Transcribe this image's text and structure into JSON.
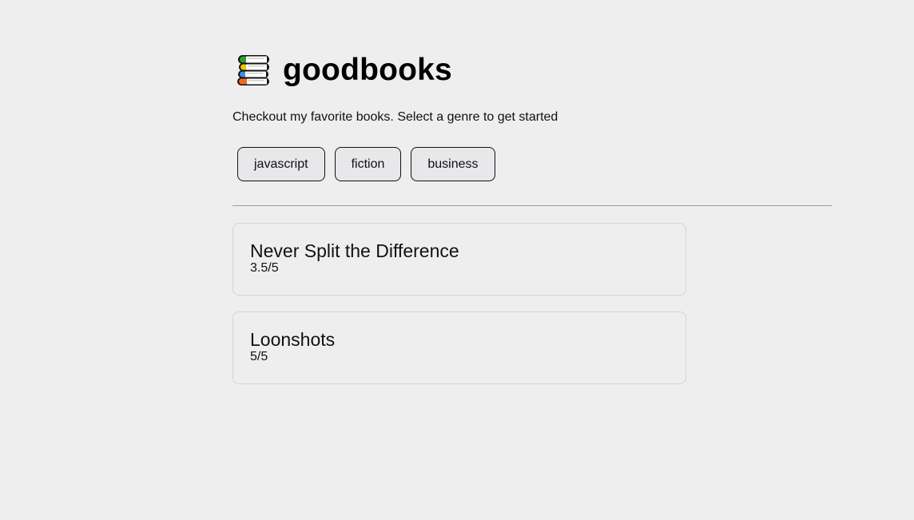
{
  "header": {
    "icon": "books-stack-icon",
    "title": "goodbooks"
  },
  "intro": {
    "text": "Checkout my favorite books. Select a genre to get started"
  },
  "genres": [
    {
      "label": "javascript"
    },
    {
      "label": "fiction"
    },
    {
      "label": "business"
    }
  ],
  "books": [
    {
      "name": "Never Split the Difference",
      "rating": "3.5/5"
    },
    {
      "name": "Loonshots",
      "rating": "5/5"
    }
  ],
  "colors": {
    "background": "#eeeeee",
    "button_bg": "#e8e8eb",
    "book_green": "#2ca02c",
    "book_yellow": "#f2c500",
    "book_blue": "#3d8fe0",
    "book_orange": "#f06a1e"
  }
}
